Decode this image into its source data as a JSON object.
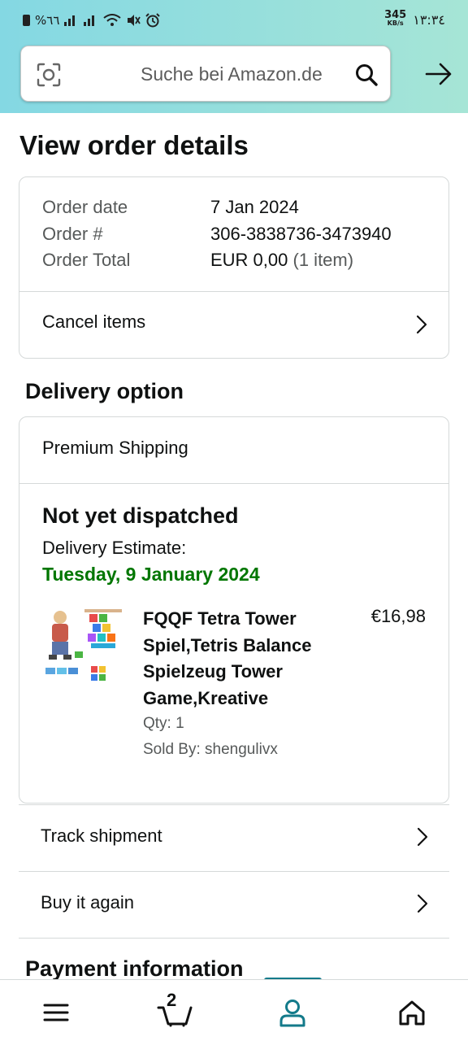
{
  "status_bar": {
    "left_text": "%٦٦",
    "speed_value": "345",
    "speed_unit": "KB/s",
    "time": "١٣:٣٤"
  },
  "search": {
    "placeholder": "Suche bei Amazon.de"
  },
  "page": {
    "title": "View order details"
  },
  "summary": {
    "rows": [
      {
        "label": "Order date",
        "value": "7 Jan 2024"
      },
      {
        "label": "Order #",
        "value": "306-3838736-3473940"
      },
      {
        "label": "Order Total",
        "value": "EUR 0,00",
        "suffix": " (1 item)"
      }
    ],
    "cancel_label": "Cancel items"
  },
  "delivery": {
    "section_title": "Delivery option",
    "shipping_method": "Premium Shipping",
    "status": "Not yet dispatched",
    "estimate_label": "Delivery Estimate:",
    "estimate_date": "Tuesday, 9 January 2024",
    "estimate_color": "#007600",
    "item": {
      "title": "FQQF Tetra Tower Spiel,Tetris Balance Spielzeug Tower Game,Kreative",
      "price": "€16,98",
      "qty": "Qty: 1",
      "seller": "Sold By: shengulivx"
    }
  },
  "actions": {
    "track": "Track shipment",
    "buy_again": "Buy it again"
  },
  "payment": {
    "section_title": "Payment information"
  },
  "bottom_nav": {
    "cart_count": "2",
    "active_color": "#137a8a",
    "items": [
      "menu-icon",
      "cart-icon",
      "account-icon",
      "home-icon"
    ]
  }
}
